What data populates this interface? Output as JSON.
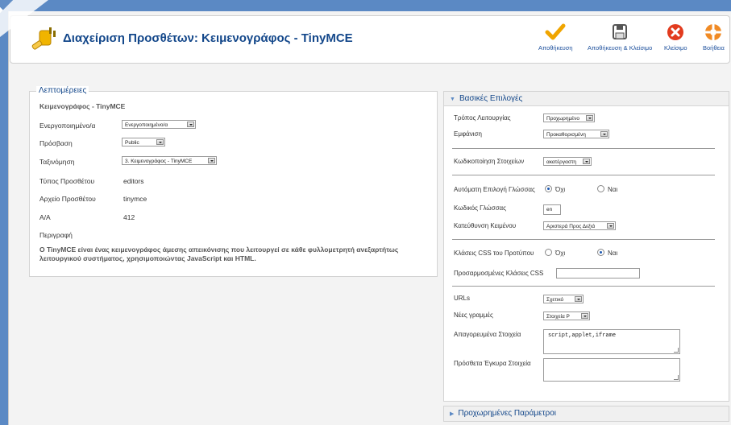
{
  "header": {
    "title": "Διαχείριση Προσθέτων: Κειμενογράφος - TinyMCE"
  },
  "toolbar": {
    "save_label": "Αποθήκευση",
    "save_close_label": "Αποθήκευση & Κλείσιμο",
    "close_label": "Κλείσιμο",
    "help_label": "Βοήθεια"
  },
  "details": {
    "legend": "Λεπτομέρειες",
    "name": "Κειμενογράφος - TinyMCE",
    "enabled_label": "Ενεργοποιημένο/α",
    "enabled_value": "Ενεργοποιημένο/α",
    "access_label": "Πρόσβαση",
    "access_value": "Public",
    "ordering_label": "Ταξινόμηση",
    "ordering_value": "3. Κειμενογράφος - TinyMCE",
    "type_label": "Τύπος Προσθέτου",
    "type_value": "editors",
    "file_label": "Αρχείο Προσθέτου",
    "file_value": "tinymce",
    "id_label": "Α/Α",
    "id_value": "412",
    "description_label": "Περιγραφή",
    "description_text": "Ο TinyMCE είναι ένας κειμενογράφος άμεσης απεικόνισης που λειτουργεί σε κάθε φυλλομετρητή ανεξαρτήτως λειτουργικού συστήματος, χρησιμοποιώντας JavaScript και HTML."
  },
  "basic": {
    "title": "Βασικές Επιλογές",
    "mode_label": "Τρόπος Λειτουργίας",
    "mode_value": "Προχωρημένο",
    "skin_label": "Εμφάνιση",
    "skin_value": "Προκαθορισμένη",
    "encoding_label": "Κωδικοποίηση Στοιχείων",
    "encoding_value": "ακατέργαστη",
    "auto_lang_label": "Αυτόματη Επιλογή Γλώσσας",
    "auto_lang_no": "Όχι",
    "auto_lang_yes": "Ναι",
    "lang_code_label": "Κωδικός Γλώσσας",
    "lang_code_value": "en",
    "direction_label": "Κατεύθυνση Κειμένου",
    "direction_value": "Αριστερά Προς Δεξιά",
    "css_classes_label": "Κλάσεις CSS του Προτύπου",
    "css_classes_no": "Όχι",
    "css_classes_yes": "Ναι",
    "custom_css_label": "Προσαρμοσμένες Κλάσεις CSS",
    "custom_css_value": "",
    "urls_label": "URLs",
    "urls_value": "Σχετικό",
    "newlines_label": "Νέες γραμμές",
    "newlines_value": "Στοιχεία P",
    "prohibited_label": "Απαγορευμένα Στοιχεία",
    "prohibited_value": "script,applet,iframe",
    "extra_label": "Πρόσθετα Έγκυρα Στοιχεία",
    "extra_value": ""
  },
  "advanced": {
    "title": "Προχωρημένες Παράμετροι"
  },
  "colors": {
    "accent": "#13478a",
    "background": "#5b89c4"
  }
}
